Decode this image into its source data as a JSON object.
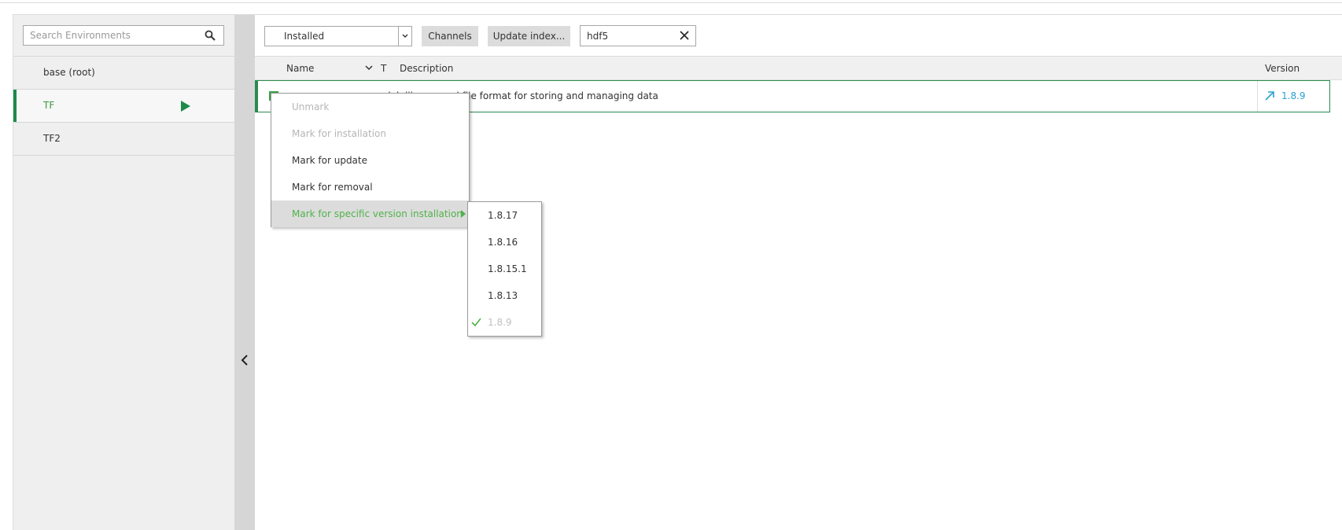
{
  "sidebar": {
    "search_placeholder": "Search Environments",
    "environments": [
      {
        "label": "base (root)",
        "selected": false
      },
      {
        "label": "TF",
        "selected": true
      },
      {
        "label": "TF2",
        "selected": false
      }
    ]
  },
  "toolbar": {
    "filter_value": "Installed",
    "channels_label": "Channels",
    "update_index_label": "Update index...",
    "search_value": "hdf5"
  },
  "table": {
    "columns": {
      "name": "Name",
      "type": "T",
      "description": "Description",
      "version": "Version"
    },
    "rows": [
      {
        "description": "del, library, and file format for storing and managing data",
        "version": "1.8.9"
      }
    ]
  },
  "context_menu": {
    "items": [
      {
        "label": "Unmark",
        "enabled": false
      },
      {
        "label": "Mark for installation",
        "enabled": false
      },
      {
        "label": "Mark for update",
        "enabled": true
      },
      {
        "label": "Mark for removal",
        "enabled": true
      },
      {
        "label": "Mark for specific version installation",
        "enabled": true,
        "active": true
      }
    ]
  },
  "version_submenu": {
    "items": [
      {
        "label": "1.8.17",
        "enabled": true
      },
      {
        "label": "1.8.16",
        "enabled": true
      },
      {
        "label": "1.8.15.1",
        "enabled": true
      },
      {
        "label": "1.8.13",
        "enabled": true
      },
      {
        "label": "1.8.9",
        "enabled": false,
        "checked": true
      }
    ]
  },
  "colors": {
    "accent_green": "#1e8a4a",
    "menu_active_text": "#4fb34a",
    "version_link": "#2aa0d0"
  },
  "icons": {
    "search": "search-icon",
    "play": "play-icon",
    "clear": "clear-icon",
    "collapse": "chevron-left-icon",
    "sort": "chevron-down-icon",
    "upgrade": "upgrade-arrow-icon",
    "submenu": "triangle-right-icon",
    "check": "check-icon"
  }
}
